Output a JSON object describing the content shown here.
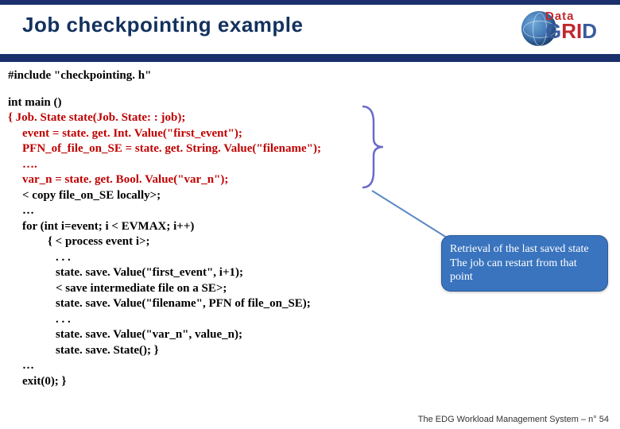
{
  "title": "Job checkpointing example",
  "logo": {
    "top": "Data",
    "bottom_g": "G",
    "bottom_ri": "RI",
    "bottom_d": "D"
  },
  "code": {
    "l01": "#include \"checkpointing. h\"",
    "l02": "int main ()",
    "l03": "{ Job. State state(Job. State: : job);",
    "l04": "event = state. get. Int. Value(\"first_event\");",
    "l05": "PFN_of_file_on_SE = state. get. String. Value(\"filename\");",
    "l06": "….",
    "l07": "var_n = state. get. Bool. Value(\"var_n\");",
    "l08": "< copy file_on_SE  locally>;",
    "l09": "…",
    "l10": "for (int i=event; i < EVMAX; i++)",
    "l11": "{  < process event i>;",
    "l12": ". . .",
    "l13": "state. save. Value(\"first_event\", i+1);",
    "l14": "< save intermediate file on a SE>;",
    "l15": "state. save. Value(\"filename\", PFN of file_on_SE);",
    "l16": ". . .",
    "l17": "state. save. Value(\"var_n\", value_n);",
    "l18": "state. save. State(); }",
    "l19": "…",
    "l20": "exit(0); }"
  },
  "callout": "Retrieval of the last saved state The job can restart from that point",
  "footer": {
    "text": "The EDG Workload Management System –  n°",
    "page": "54"
  }
}
